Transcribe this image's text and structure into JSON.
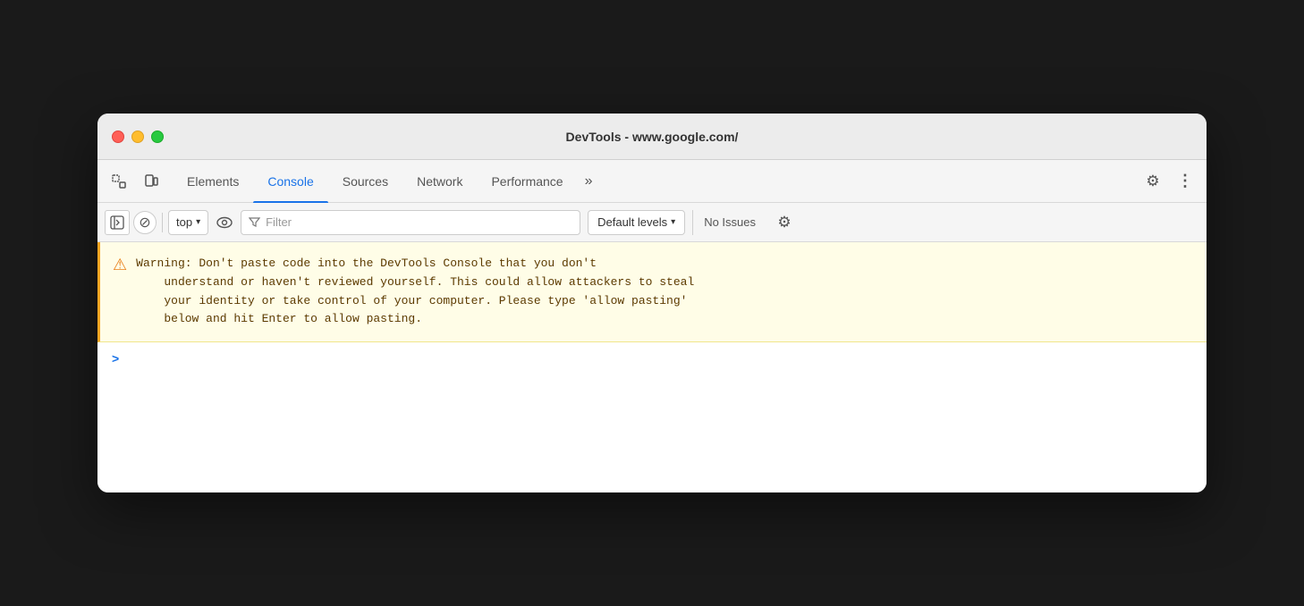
{
  "window": {
    "title": "DevTools - www.google.com/"
  },
  "traffic_lights": {
    "close_label": "close",
    "minimize_label": "minimize",
    "maximize_label": "maximize"
  },
  "tab_bar": {
    "tabs": [
      {
        "id": "elements",
        "label": "Elements",
        "active": false
      },
      {
        "id": "console",
        "label": "Console",
        "active": true
      },
      {
        "id": "sources",
        "label": "Sources",
        "active": false
      },
      {
        "id": "network",
        "label": "Network",
        "active": false
      },
      {
        "id": "performance",
        "label": "Performance",
        "active": false
      }
    ],
    "more_label": "»",
    "settings_label": "⚙",
    "more_options_label": "⋮",
    "inspect_icon": "⬚",
    "device_icon": "⬓"
  },
  "console_toolbar": {
    "sidebar_icon": "▶|",
    "clear_icon": "⊘",
    "top_label": "top",
    "dropdown_arrow": "▾",
    "eye_icon": "👁",
    "filter_placeholder": "Filter",
    "filter_icon": "⛉",
    "levels_label": "Default levels",
    "levels_arrow": "▾",
    "no_issues_label": "No Issues",
    "settings_icon": "⚙"
  },
  "warning": {
    "icon": "⚠",
    "text": "Warning: Don't paste code into the DevTools Console that you don't\n    understand or haven't reviewed yourself. This could allow attackers to steal\n    your identity or take control of your computer. Please type 'allow pasting'\n    below and hit Enter to allow pasting."
  },
  "prompt": {
    "chevron": ">"
  }
}
